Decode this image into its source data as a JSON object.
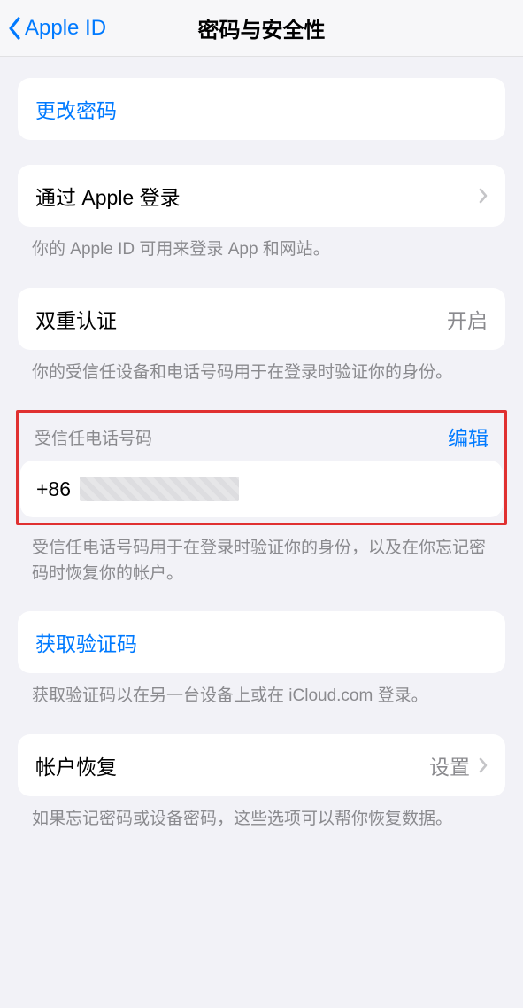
{
  "nav": {
    "back_label": "Apple ID",
    "title": "密码与安全性"
  },
  "change_password": {
    "label": "更改密码"
  },
  "sign_in_with_apple": {
    "label": "通过 Apple 登录",
    "footer": "你的 Apple ID 可用来登录 App 和网站。"
  },
  "two_factor": {
    "label": "双重认证",
    "value": "开启",
    "footer": "你的受信任设备和电话号码用于在登录时验证你的身份。"
  },
  "trusted_phone": {
    "header": "受信任电话号码",
    "edit": "编辑",
    "prefix": "+86",
    "footer": "受信任电话号码用于在登录时验证你的身份，以及在你忘记密码时恢复你的帐户。"
  },
  "get_code": {
    "label": "获取验证码",
    "footer": "获取验证码以在另一台设备上或在 iCloud.com 登录。"
  },
  "account_recovery": {
    "label": "帐户恢复",
    "value": "设置",
    "footer": "如果忘记密码或设备密码，这些选项可以帮你恢复数据。"
  }
}
